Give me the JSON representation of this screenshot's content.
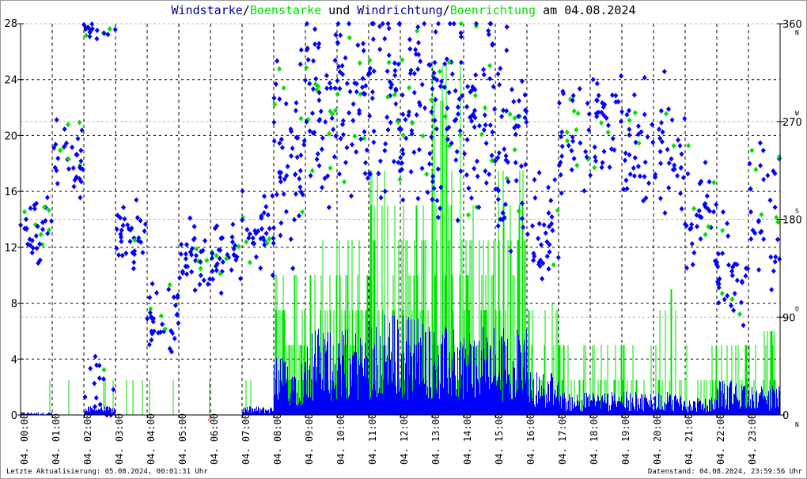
{
  "chart_data": {
    "type": "scatter",
    "title_parts": [
      {
        "text": "Windstarke",
        "color": "#0000a0"
      },
      {
        "text": "/",
        "color": "#000000"
      },
      {
        "text": "Boenstarke",
        "color": "#00e000"
      },
      {
        "text": " und ",
        "color": "#000000"
      },
      {
        "text": "Windrichtung",
        "color": "#0000a0"
      },
      {
        "text": "/",
        "color": "#000000"
      },
      {
        "text": "Boenrichtung",
        "color": "#00e000"
      },
      {
        "text": " am 04.08.2024",
        "color": "#000000"
      }
    ],
    "left_axis": {
      "ylim": [
        0,
        28
      ],
      "ticks": [
        "0",
        "4",
        "8",
        "12",
        "16",
        "20",
        "24",
        "28"
      ]
    },
    "right_axis": {
      "ylim": [
        0,
        360
      ],
      "ticks": [
        "0",
        "90",
        "180",
        "270",
        "360"
      ],
      "compass": [
        "N",
        "O",
        "S",
        "W",
        "N"
      ]
    },
    "x_labels": [
      "04. 00:00",
      "04. 01:00",
      "04. 02:00",
      "04. 03:00",
      "04. 04:00",
      "04. 05:00",
      "04. 06:00",
      "04. 07:00",
      "04. 08:00",
      "04. 09:00",
      "04. 10:00",
      "04. 11:00",
      "04. 12:00",
      "04. 13:00",
      "04. 14:00",
      "04. 15:00",
      "04. 16:00",
      "04. 17:00",
      "04. 18:00",
      "04. 19:00",
      "04. 20:00",
      "04. 21:00",
      "04. 22:00",
      "04. 23:00"
    ],
    "marker": "0",
    "series": [
      {
        "name": "Windstarke",
        "color": "#0000ff",
        "hourly_mean": [
          0.1,
          0,
          0.3,
          0,
          0,
          0,
          0,
          0.3,
          2,
          3,
          3,
          3.5,
          3.5,
          3,
          3,
          3,
          1.5,
          0.8,
          0.8,
          0.8,
          0.8,
          0.6,
          1.2,
          1
        ]
      },
      {
        "name": "Boenstarke",
        "color": "#00e000",
        "hourly_max": [
          2.5,
          2.5,
          2.5,
          2.5,
          2.5,
          2.5,
          0,
          2.5,
          10,
          13,
          13,
          18,
          16,
          26,
          16,
          18,
          8,
          5,
          5,
          5,
          9,
          5,
          5,
          6
        ]
      },
      {
        "name": "Windrichtung",
        "color": "#0000ff",
        "hourly_deg": [
          165,
          230,
          20,
          165,
          85,
          140,
          150,
          170,
          250,
          280,
          290,
          290,
          285,
          280,
          270,
          260,
          185,
          250,
          265,
          240,
          240,
          190,
          120,
          185
        ]
      },
      {
        "name": "Boenrichtung",
        "color": "#00e000",
        "hourly_deg": [
          165,
          225,
          20,
          165,
          85,
          140,
          150,
          170,
          250,
          280,
          290,
          290,
          285,
          280,
          270,
          260,
          185,
          250,
          265,
          240,
          240,
          190,
          120,
          185
        ]
      }
    ]
  },
  "footer": {
    "left": "Letzte Aktualisierung: 05.08.2024, 00:01:31 Uhr",
    "right": "Datenstand: 04.08.2024, 23:59:56 Uhr"
  }
}
